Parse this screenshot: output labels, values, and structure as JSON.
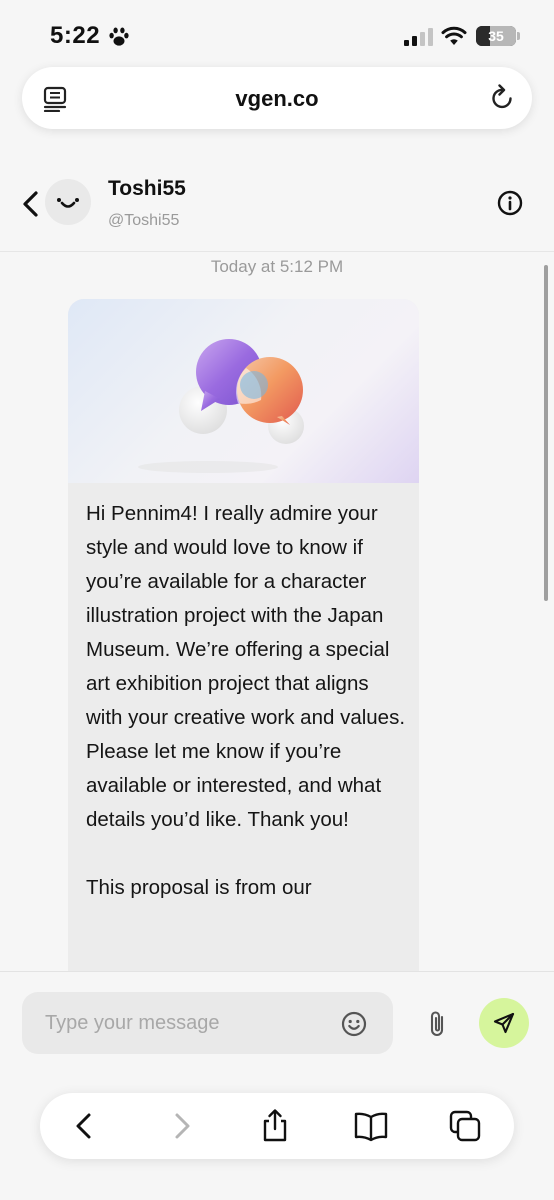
{
  "status_bar": {
    "time": "5:22",
    "battery_level": "35",
    "icons": [
      "paw-icon",
      "cellular-signal-icon",
      "wifi-icon",
      "battery-icon"
    ]
  },
  "browser": {
    "url": "vgen.co",
    "icons": [
      "reader-icon",
      "reload-icon"
    ]
  },
  "chat_header": {
    "name": "Toshi55",
    "handle": "@Toshi55",
    "icons": [
      "back-chevron-icon",
      "avatar-smiley-icon",
      "info-icon"
    ]
  },
  "conversation": {
    "timestamp": "Today at 5:12 PM",
    "message": {
      "image_icon": "chat-bubbles-illustration",
      "text": "Hi Pennim4! I really admire your style and would love to know if you’re available for a character illustration project with the Japan Museum. We’re offering a special art exhibition project that aligns with your creative work and values. Please let me know if you’re available or interested, and what details you’d like. Thank you!\n\nThis proposal is from our"
    }
  },
  "composer": {
    "placeholder": "Type your message",
    "icons": [
      "emoji-icon",
      "paperclip-icon",
      "send-icon"
    ],
    "send_color": "#d6f59c"
  },
  "toolbar": {
    "icons": [
      "back-icon",
      "forward-icon",
      "share-icon",
      "bookmarks-icon",
      "tabs-icon"
    ]
  }
}
